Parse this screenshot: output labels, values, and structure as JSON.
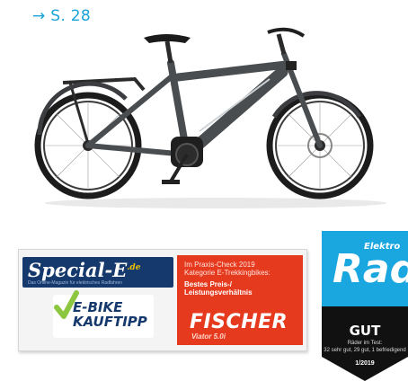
{
  "page_reference": "→ S. 28",
  "product_image": {
    "icon": "e-bike-trekking-photo",
    "frame_color": "#4a4d50"
  },
  "badge_special_e": {
    "logo": "Special-E",
    "logo_suffix": ".de",
    "tagline": "Das Online-Magazin für elektrisches Radfahren",
    "kauftipp_line1": "E-BIKE",
    "kauftipp_line2": "KAUFTIPP",
    "info_lines": [
      "Im Praxis-Check 2019",
      "Kategorie E-Trekkingbikes:",
      "Bestes Preis-/",
      "Leistungsverhältnis"
    ],
    "brand": "FISCHER",
    "model": "Viator 5.0i",
    "colors": {
      "navy": "#16396d",
      "red": "#e53a1e",
      "green": "#8dc63f"
    }
  },
  "badge_elektrorad": {
    "logo_small": "Elektro",
    "logo_big": "Rad",
    "grade": "GUT",
    "detail_line1": "Räder im Test:",
    "detail_line2": "32 sehr gut, 29 gut, 1 befriedigend",
    "issue": "1/2019",
    "colors": {
      "blue": "#1aa6df",
      "black": "#111111"
    }
  }
}
